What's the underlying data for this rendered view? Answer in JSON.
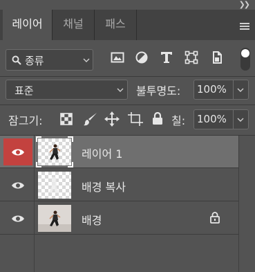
{
  "panel": {
    "collapse_icon": "double-chevron-right-icon"
  },
  "tabs": [
    {
      "label": "레이어",
      "active": true
    },
    {
      "label": "채널",
      "active": false
    },
    {
      "label": "패스",
      "active": false
    }
  ],
  "filter": {
    "kind_label": "종류",
    "icons": [
      "image-filter-icon",
      "adjustment-filter-icon",
      "type-filter-icon",
      "shape-filter-icon",
      "smart-object-filter-icon"
    ]
  },
  "blend": {
    "mode": "표준",
    "opacity_label": "불투명도:",
    "opacity_value": "100%"
  },
  "lock": {
    "label": "잠그기:",
    "icons": [
      "lock-transparent-icon",
      "lock-image-icon",
      "lock-position-icon",
      "lock-artboard-icon",
      "lock-all-icon"
    ],
    "fill_label": "칠:",
    "fill_value": "100%"
  },
  "layers": [
    {
      "name": "레이어 1",
      "selected": true,
      "visible": true
    },
    {
      "name": "배경 복사",
      "selected": false,
      "visible": true
    },
    {
      "name": "배경",
      "selected": false,
      "visible": true,
      "locked": true
    }
  ],
  "colors": {
    "panel_bg": "#535353",
    "tabbar_bg": "#424242",
    "selected_row": "#6f6f6f",
    "eye_highlight": "#c3423f"
  }
}
